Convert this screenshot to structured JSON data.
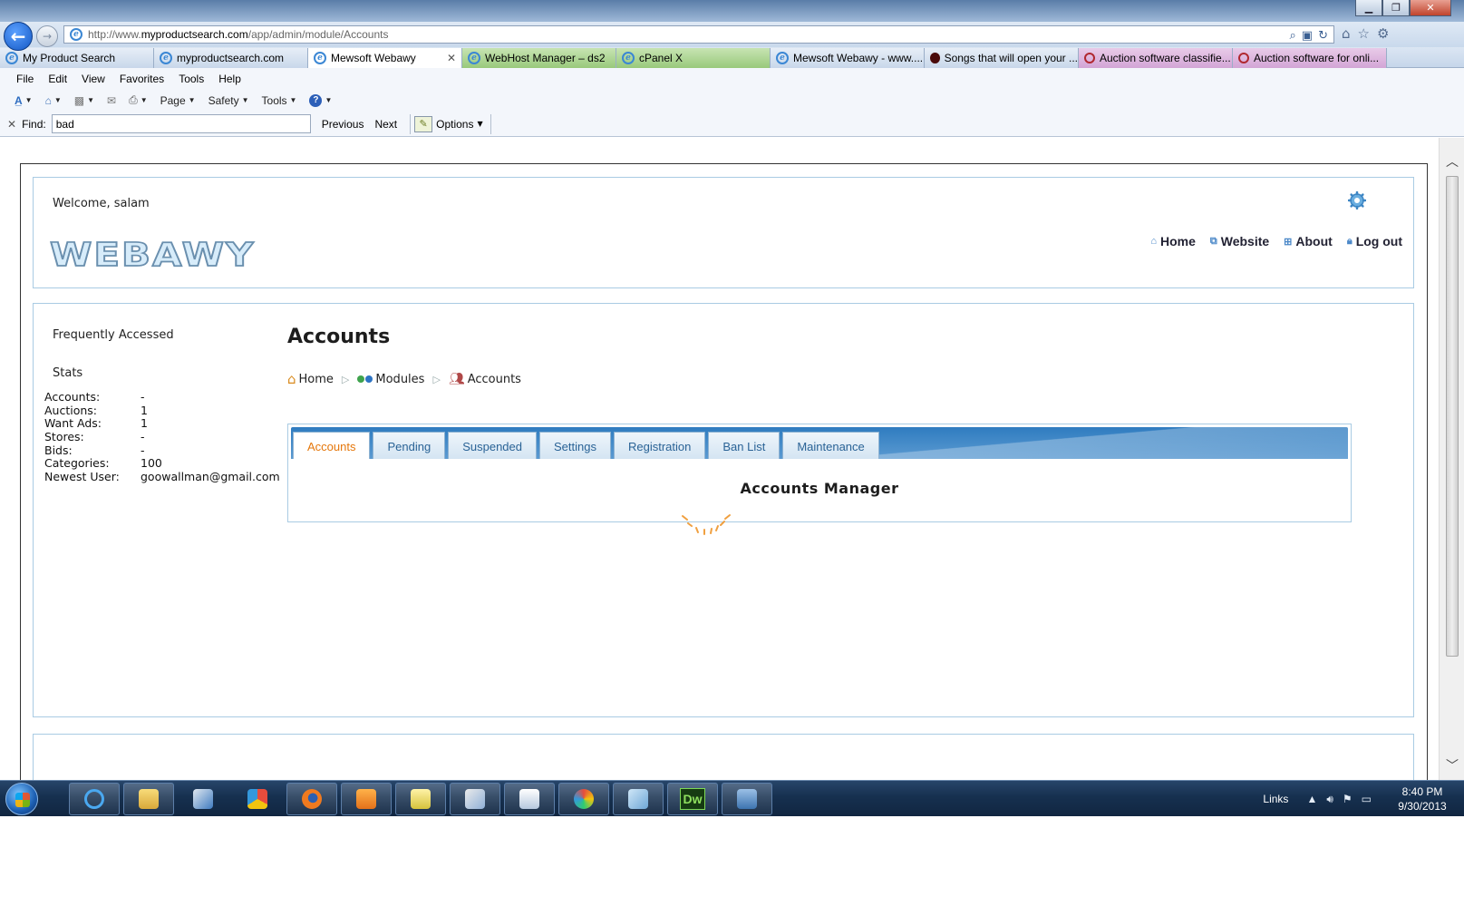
{
  "browser": {
    "url_prefix": "http://www.",
    "url_domain": "myproductsearch.com",
    "url_path": "/app/admin/module/Accounts",
    "tabs": [
      {
        "label": "My Product Search"
      },
      {
        "label": "myproductsearch.com"
      },
      {
        "label": "Mewsoft Webawy"
      },
      {
        "label": "WebHost Manager – ds2"
      },
      {
        "label": "cPanel X"
      },
      {
        "label": "Mewsoft Webawy - www...."
      },
      {
        "label": "Songs that will open your ..."
      },
      {
        "label": "Auction software classifie..."
      },
      {
        "label": "Auction software for onli..."
      }
    ],
    "menu": [
      "File",
      "Edit",
      "View",
      "Favorites",
      "Tools",
      "Help"
    ],
    "commands": {
      "page": "Page",
      "safety": "Safety",
      "tools": "Tools"
    },
    "find": {
      "label": "Find:",
      "value": "bad",
      "previous": "Previous",
      "next": "Next",
      "options": "Options"
    }
  },
  "header": {
    "welcome": "Welcome, salam",
    "logo": "WEBAWY",
    "nav": [
      {
        "label": "Home"
      },
      {
        "label": "Website"
      },
      {
        "label": "About"
      },
      {
        "label": "Log out"
      }
    ]
  },
  "sidebar": {
    "frequently_accessed": "Frequently Accessed",
    "stats_title": "Stats",
    "stats": [
      {
        "key": "Accounts:",
        "value": "-"
      },
      {
        "key": "Auctions:",
        "value": "1"
      },
      {
        "key": "Want Ads:",
        "value": "1"
      },
      {
        "key": "Stores:",
        "value": "-"
      },
      {
        "key": "Bids:",
        "value": "-"
      },
      {
        "key": "Categories:",
        "value": "100"
      },
      {
        "key": "Newest User:",
        "value": "goowallman@gmail.com"
      }
    ]
  },
  "main": {
    "title": "Accounts",
    "breadcrumb": [
      "Home",
      "Modules",
      "Accounts"
    ],
    "tabs": [
      "Accounts",
      "Pending",
      "Suspended",
      "Settings",
      "Registration",
      "Ban List",
      "Maintenance"
    ],
    "active_tab": "Accounts",
    "panel_title": "Accounts Manager"
  },
  "taskbar": {
    "links": "Links",
    "time": "8:40 PM",
    "date": "9/30/2013",
    "dw_label": "Dw"
  },
  "colors": {
    "accent_blue": "#2f7cc0",
    "active_tab_text": "#e5770b",
    "box_border": "#a9cbe3"
  }
}
